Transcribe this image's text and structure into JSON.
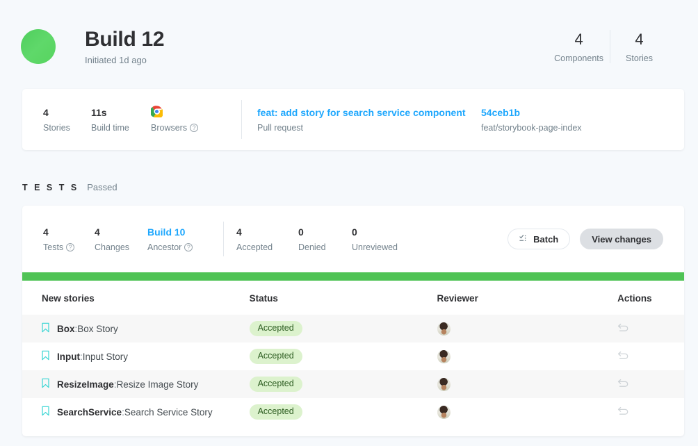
{
  "header": {
    "avatar_name": "build-status-avatar",
    "title": "Build 12",
    "subtitle": "Initiated 1d ago",
    "stats": [
      {
        "value": "4",
        "label": "Components"
      },
      {
        "value": "4",
        "label": "Stories"
      }
    ]
  },
  "info_card": {
    "stories": {
      "value": "4",
      "label": "Stories"
    },
    "build_time": {
      "value": "11s",
      "label": "Build time"
    },
    "browsers": {
      "label": "Browsers",
      "icon": "chrome-icon",
      "help": "?"
    },
    "pull_request": {
      "title": "feat: add story for search service component",
      "caption": "Pull request"
    },
    "commit": {
      "hash": "54ceb1b",
      "branch": "feat/storybook-page-index"
    }
  },
  "tests_section": {
    "heading": "T E S T S",
    "status": "Passed",
    "summary": {
      "tests": {
        "value": "4",
        "label": "Tests",
        "help": "?"
      },
      "changes": {
        "value": "4",
        "label": "Changes"
      },
      "ancestor": {
        "value": "Build 10",
        "label": "Ancestor",
        "help": "?"
      },
      "accepted": {
        "value": "4",
        "label": "Accepted"
      },
      "denied": {
        "value": "0",
        "label": "Denied"
      },
      "unreviewed": {
        "value": "0",
        "label": "Unreviewed"
      }
    },
    "buttons": {
      "batch": "Batch",
      "view_changes": "View changes"
    },
    "progress_color": "#4fc355"
  },
  "table": {
    "columns": {
      "stories": "New stories",
      "status": "Status",
      "reviewer": "Reviewer",
      "actions": "Actions"
    },
    "rows": [
      {
        "component": "Box",
        "separator": ":",
        "story": "Box Story",
        "status": "Accepted",
        "reviewer": "reviewer-avatar",
        "action": "undo-icon"
      },
      {
        "component": "Input",
        "separator": ":",
        "story": "Input Story",
        "status": "Accepted",
        "reviewer": "reviewer-avatar",
        "action": "undo-icon"
      },
      {
        "component": "ResizeImage",
        "separator": ":",
        "story": "Resize Image Story",
        "status": "Accepted",
        "reviewer": "reviewer-avatar",
        "action": "undo-icon"
      },
      {
        "component": "SearchService",
        "separator": ":",
        "story": "Search Service Story",
        "status": "Accepted",
        "reviewer": "reviewer-avatar",
        "action": "undo-icon"
      }
    ]
  },
  "colors": {
    "page_bg": "#f6f9fc",
    "accent_link": "#1ea7fd",
    "success": "#4fc355",
    "accepted_text": "#448028",
    "denied_text": "#d43900",
    "unreviewed_text": "#a15c07",
    "pill_bg": "#dcf2cd",
    "bookmark": "#37d5d3"
  }
}
